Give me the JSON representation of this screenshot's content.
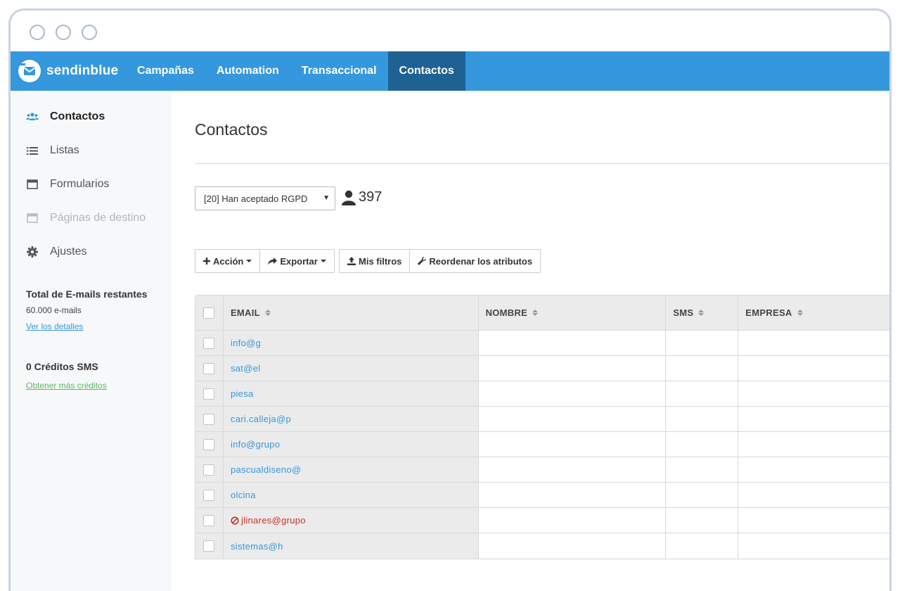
{
  "brand": {
    "name": "sendinblue",
    "nav_color": "#3598dc",
    "active_color": "#1e6294"
  },
  "nav": {
    "items": [
      {
        "label": "Campañas",
        "active": false
      },
      {
        "label": "Automation",
        "active": false
      },
      {
        "label": "Transaccional",
        "active": false
      },
      {
        "label": "Contactos",
        "active": true
      }
    ]
  },
  "sidebar": {
    "items": [
      {
        "label": "Contactos",
        "icon": "users-icon",
        "state": "active"
      },
      {
        "label": "Listas",
        "icon": "list-icon",
        "state": "normal"
      },
      {
        "label": "Formularios",
        "icon": "form-window-icon",
        "state": "normal"
      },
      {
        "label": "Páginas de destino",
        "icon": "landing-page-icon",
        "state": "disabled"
      },
      {
        "label": "Ajustes",
        "icon": "gear-icon",
        "state": "normal"
      }
    ],
    "emails": {
      "title": "Total de E-mails restantes",
      "count": "60.000 e-mails",
      "link": "Ver los detalles"
    },
    "sms": {
      "title": "0 Créditos SMS",
      "link": "Obtener más créditos"
    }
  },
  "main": {
    "title": "Contactos",
    "list_select": {
      "value": "[20] Han aceptado RGPD"
    },
    "contact_count": "397",
    "buttons": {
      "accion": "Acción",
      "exportar": "Exportar",
      "mis_filtros": "Mis filtros",
      "reordenar": "Reordenar los atributos"
    },
    "table": {
      "columns": [
        "EMAIL",
        "NOMBRE",
        "SMS",
        "EMPRESA"
      ],
      "rows": [
        {
          "email": "info@g",
          "blocked": false
        },
        {
          "email": "sat@el",
          "blocked": false
        },
        {
          "email": "piesa",
          "blocked": false
        },
        {
          "email": "cari.calleja@p",
          "blocked": false
        },
        {
          "email": "info@grupo",
          "blocked": false
        },
        {
          "email": "pascualdiseno@",
          "blocked": false
        },
        {
          "email": "olcina",
          "blocked": false
        },
        {
          "email": "jlinares@grupo",
          "blocked": true
        },
        {
          "email": "sistemas@h",
          "blocked": false
        }
      ]
    }
  }
}
